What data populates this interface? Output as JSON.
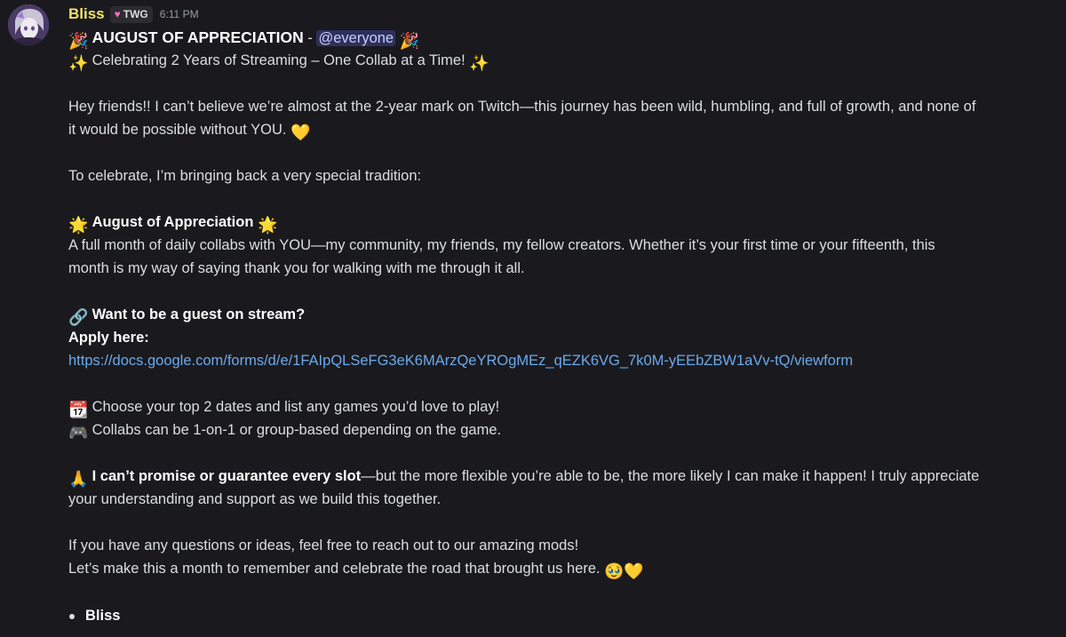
{
  "message": {
    "author": "Bliss",
    "role_tag": "TWG",
    "timestamp": "6:11 PM",
    "title": "AUGUST OF APPRECIATION",
    "title_separator": " - ",
    "mention": "@everyone",
    "subtitle": "Celebrating 2 Years of Streaming – One Collab at a Time!",
    "para1_line1": "Hey friends!! I can’t believe we’re almost at the 2-year mark on Twitch—this journey has been wild, humbling, and full of growth, and none of",
    "para1_line2": "it would be possible without YOU.",
    "para2": "To celebrate, I’m bringing back a very special tradition:",
    "section_title": "August of Appreciation",
    "para3_line1": "A full month of daily collabs with YOU—my community, my friends, my fellow creators. Whether it’s your first time or your fifteenth, this",
    "para3_line2": "month is my way of saying thank you for walking with me through it all.",
    "guest_heading": "Want to be a guest on stream?",
    "apply_label": "Apply here:",
    "apply_link": "https://docs.google.com/forms/d/e/1FAIpQLSeFG3eK6MArzQeYROgMEz_qEZK6VG_7k0M-yEEbZBW1aVv-tQ/viewform",
    "dates_line": "Choose your top 2 dates and list any games you’d love to play!",
    "collab_line": "Collabs can be 1-on-1 or group-based depending on the game.",
    "promise_bold": "I can’t promise or guarantee every slot",
    "promise_rest": "—but the more flexible you’re able to be, the more likely I can make it happen! I truly appreciate",
    "promise_line2": "your understanding and support as we build this together.",
    "questions_line": "If you have any questions or ideas, feel free to reach out to our amazing mods!",
    "closing_line": "Let’s make this a month to remember and celebrate the road that brought us here.",
    "list_item": "Bliss"
  },
  "icons": {
    "party_popper": "party-popper-icon",
    "sparkles": "sparkles-icon",
    "sun": "sun-icon",
    "link": "link-icon",
    "calendar": "calendar-icon",
    "gamepad": "gamepad-icon",
    "pray": "folded-hands-icon",
    "yellow_heart": "yellow-heart-icon",
    "pleading_face": "pleading-face-icon"
  },
  "colors": {
    "background": "#1a1a1e",
    "username": "#f0e26a",
    "link": "#6aa9ee",
    "mention_bg": "#3b3f6e",
    "text": "#dbdee1"
  }
}
